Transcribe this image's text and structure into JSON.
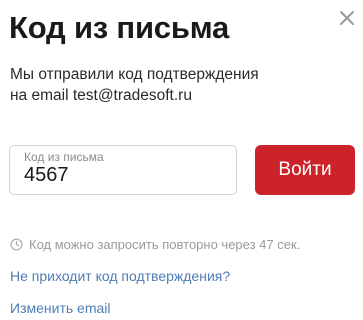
{
  "header": {
    "title": "Код из письма"
  },
  "description": {
    "line1": "Мы отправили код подтверждения",
    "line2": "на email test@tradesoft.ru"
  },
  "code_field": {
    "label": "Код из письма",
    "value": "4567"
  },
  "submit_button": {
    "label": "Войти"
  },
  "resend": {
    "text": "Код можно запросить повторно через 47 сек."
  },
  "links": {
    "help": "Не приходит код подтверждения?",
    "change_email": "Изменить email"
  },
  "icons": {
    "close": "close-icon",
    "clock": "clock-icon"
  },
  "colors": {
    "accent": "#cc2229",
    "link": "#4f7db6",
    "muted": "#9a9a9a"
  }
}
